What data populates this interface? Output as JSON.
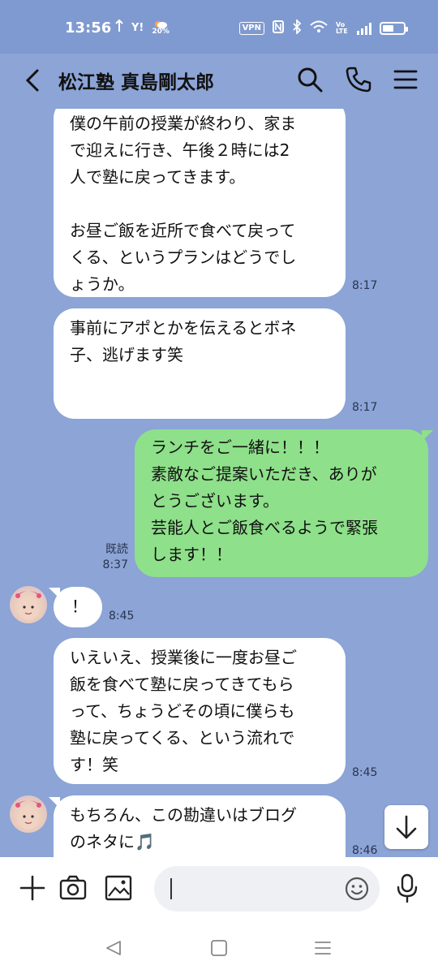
{
  "status_bar": {
    "time": "13:56",
    "icons_left": [
      "arrow-icon",
      "yahoo-icon",
      "weather-icon"
    ],
    "yahoo_label": "Y!",
    "weather_pct": "20%",
    "vpn_label": "VPN",
    "lte_label": "Vo LTE",
    "battery_level": 0.55
  },
  "header": {
    "title": "松江塾 真島剛太郎"
  },
  "messages": [
    {
      "side": "in",
      "text": "僕の午前の授業が終わり、家ま\nで迎えに行き、午後２時には2\n人で塾に戻ってきます。\n\nお昼ご飯を近所で食べて戻って\nくる、というプランはどうでし\nょうか。",
      "time": "8:17"
    },
    {
      "side": "in",
      "text": "事前にアポとかを伝えるとボネ\n子、逃げます笑",
      "time": "8:17"
    },
    {
      "side": "out",
      "text": "ランチをご一緒に！！！\n素敵なご提案いただき、ありが\nとうございます。\n芸能人とご飯食べるようで緊張\nします！！",
      "read": "既読",
      "time": "8:37"
    },
    {
      "side": "in",
      "text": "！",
      "time": "8:45"
    },
    {
      "side": "in",
      "text": "いえいえ、授業後に一度お昼ご\n飯を食べて塾に戻ってきてもら\nって、ちょうどその頃に僕らも\n塾に戻ってくる、という流れで\nす！笑",
      "time": "8:45"
    },
    {
      "side": "in",
      "text": "もちろん、この勘違いはブログ\nのネタに🎵",
      "time": "8:46"
    }
  ],
  "input": {
    "placeholder": ""
  }
}
